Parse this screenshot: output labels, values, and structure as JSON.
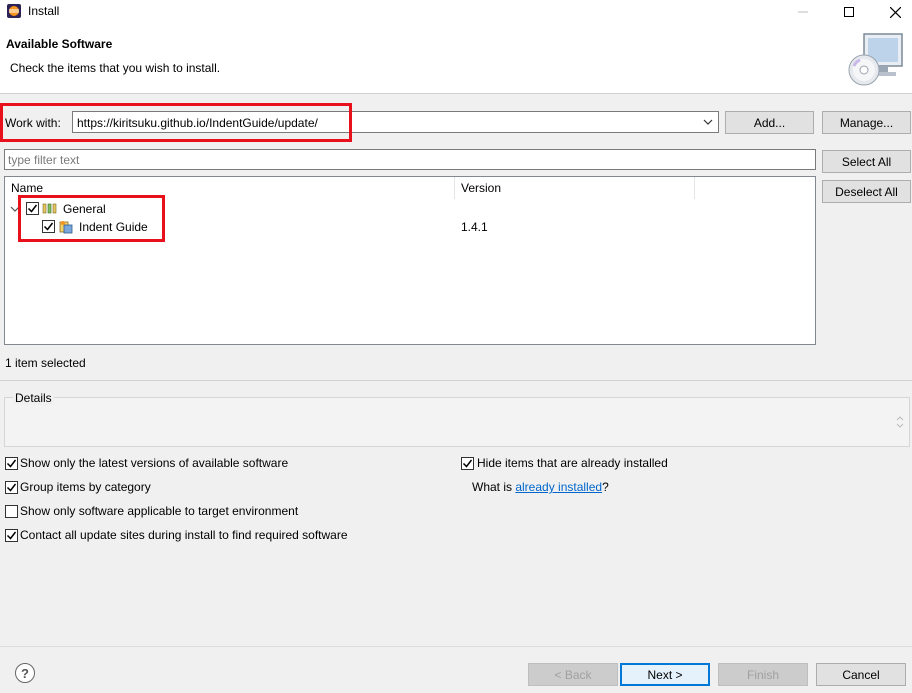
{
  "window": {
    "title": "Install"
  },
  "header": {
    "title": "Available Software",
    "subtitle": "Check the items that you wish to install."
  },
  "work_with": {
    "label": "Work with:",
    "value": "https://kiritsuku.github.io/IndentGuide/update/",
    "add_label": "Add...",
    "manage_label": "Manage..."
  },
  "filter": {
    "placeholder": "type filter text"
  },
  "side_buttons": {
    "select_all": "Select All",
    "deselect_all": "Deselect All"
  },
  "table": {
    "columns": [
      "Name",
      "Version"
    ],
    "rows": [
      {
        "name": "General",
        "version": "",
        "checked": true,
        "expanded": true,
        "level": 0
      },
      {
        "name": "Indent Guide",
        "version": "1.4.1",
        "checked": true,
        "level": 1
      }
    ]
  },
  "selection_status": "1 item selected",
  "details": {
    "label": "Details"
  },
  "options": {
    "latest_versions": {
      "label": "Show only the latest versions of available software",
      "checked": true
    },
    "group_by_category": {
      "label": "Group items by category",
      "checked": true
    },
    "target_env": {
      "label": "Show only software applicable to target environment",
      "checked": false
    },
    "contact_sites": {
      "label": "Contact all update sites during install to find required software",
      "checked": true
    },
    "hide_installed": {
      "label": "Hide items that are already installed",
      "checked": true
    },
    "what_is_prefix": "What is ",
    "what_is_link": "already installed",
    "what_is_suffix": "?"
  },
  "footer": {
    "help": "?",
    "back": "< Back",
    "next": "Next >",
    "finish": "Finish",
    "cancel": "Cancel"
  },
  "colors": {
    "highlight": "#e8101a",
    "link": "#0066cc",
    "default_button": "#0078d7"
  }
}
